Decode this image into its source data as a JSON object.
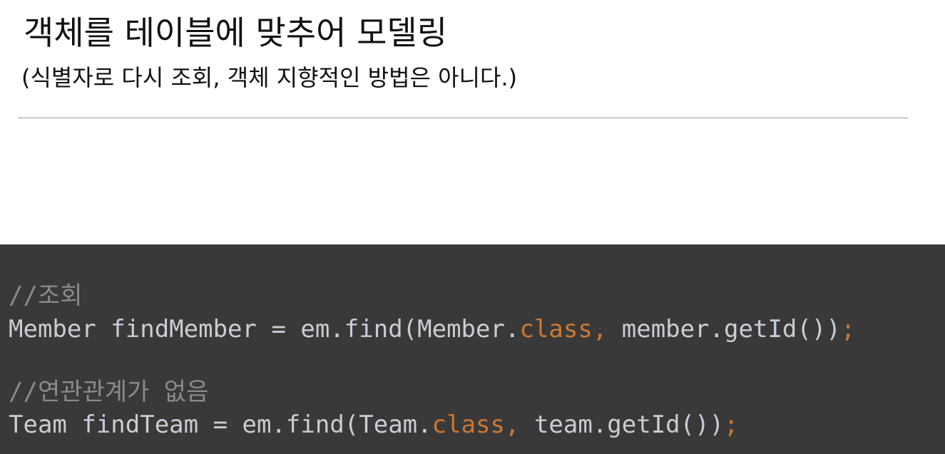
{
  "slide": {
    "title": "객체를 테이블에 맞추어 모델링",
    "subtitle": "(식별자로 다시 조회, 객체 지향적인 방법은 아니다.)"
  },
  "code": {
    "comment_lookup": "//조회",
    "line1": {
      "before": "Member findMember = em.find(Member.",
      "keyword": "class",
      "comma": ",",
      "after": " member.getId())",
      "semicolon": ";"
    },
    "comment_no_relation": "//연관관계가 없음",
    "line2": {
      "before": "Team findTeam = em.find(Team.",
      "keyword": "class",
      "comma": ",",
      "after": " team.getId())",
      "semicolon": ";"
    }
  },
  "colors": {
    "code_background": "#393939",
    "code_text": "#c9cdd3",
    "comment": "#8a8a8a",
    "keyword": "#cc7832",
    "divider": "#9a9a9a"
  }
}
